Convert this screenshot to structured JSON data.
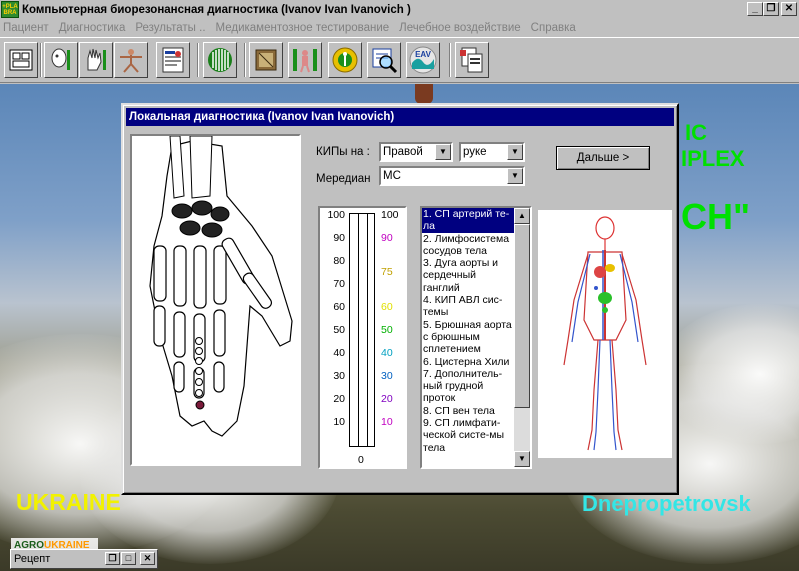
{
  "window": {
    "title": "Компьютерная биорезонансная диагностика (Ivanov Ivan Ivanovich )",
    "icon_label_1": "+PLA",
    "icon_label_2": "BRA"
  },
  "menu": [
    {
      "label": "Пациент"
    },
    {
      "label": "Диагностика"
    },
    {
      "label": "Результаты .."
    },
    {
      "label": "Медикаментозное тестирование"
    },
    {
      "label": "Лечебное воздействие"
    },
    {
      "label": "Справка"
    }
  ],
  "toolbar": {
    "icons": [
      "patients-icon",
      "head-diagnosis-icon",
      "hand-diagnosis-icon",
      "vitruvian-man-icon",
      "report-chart-icon",
      "signal-bars-icon",
      "book-icon",
      "body-scan-icon",
      "meridian-wheel-icon",
      "magnifier-icon",
      "eav-icon",
      "document-print-icon"
    ],
    "eav_label": "EAV"
  },
  "background": {
    "text_ic": "IC",
    "text_plex": "IPLEX",
    "text_ch": "CH\"",
    "text_ukraine": "UKRAINE",
    "text_city": "Dnepropetrovsk",
    "colors": {
      "green": "#00e000",
      "yellow": "#f2f200",
      "cyan": "#33e6e6"
    }
  },
  "dialog": {
    "title": "Локальная диагностика (Ivanov Ivan Ivanovich)",
    "kip_label": "КИПы на :",
    "side_value": "Правой",
    "limb_value": "руке",
    "meridian_label": "Мередиан",
    "meridian_value": "MC",
    "next_button": "Дальше >",
    "scale_left": [
      "100",
      "90",
      "80",
      "70",
      "60",
      "50",
      "40",
      "30",
      "20",
      "10"
    ],
    "scale_right": [
      {
        "v": "100",
        "c": "#000000"
      },
      {
        "v": "90",
        "c": "#c000c0"
      },
      {
        "v": "75",
        "c": "#c0a000"
      },
      {
        "v": "60",
        "c": "#e0e000"
      },
      {
        "v": "50",
        "c": "#00b000"
      },
      {
        "v": "40",
        "c": "#00a0c0"
      },
      {
        "v": "30",
        "c": "#0060c0"
      },
      {
        "v": "20",
        "c": "#8000c0"
      },
      {
        "v": "10",
        "c": "#c000c0"
      }
    ],
    "scale_zero": "0",
    "list": [
      {
        "text": "1. СП артерий те-ла",
        "selected": true
      },
      {
        "text": "2. Лимфосистема сосудов тела",
        "selected": false
      },
      {
        "text": "3. Дуга аорты и сердечный ганглий",
        "selected": false
      },
      {
        "text": "4. КИП АВЛ сис-темы",
        "selected": false
      },
      {
        "text": "5. Брюшная аорта с брюшным сплетением",
        "selected": false
      },
      {
        "text": "6. Цистерна Хили",
        "selected": false
      },
      {
        "text": "7. Дополнитель-ный грудной проток",
        "selected": false
      },
      {
        "text": "8. СП вен тела",
        "selected": false
      },
      {
        "text": "9. СП лимфати-ческой систе-мы тела",
        "selected": false
      }
    ]
  },
  "mini_window": {
    "label": "Рецепт",
    "agro_a": "AGRO",
    "agro_b": "UKRAINE"
  }
}
